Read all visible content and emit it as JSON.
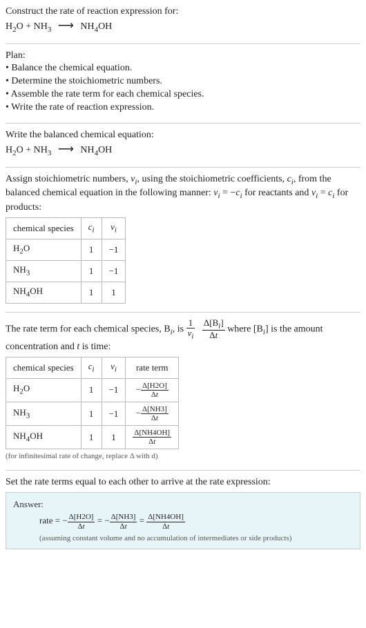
{
  "header": {
    "prompt": "Construct the rate of reaction expression for:"
  },
  "equation": {
    "r1": "H",
    "r1sub": "2",
    "r1tail": "O",
    "plus": " + ",
    "r2": "NH",
    "r2sub": "3",
    "arrow": "⟶",
    "p1": "NH",
    "p1sub": "4",
    "p1tail": "OH"
  },
  "plan": {
    "title": "Plan:",
    "b1": "• Balance the chemical equation.",
    "b2": "• Determine the stoichiometric numbers.",
    "b3": "• Assemble the rate term for each chemical species.",
    "b4": "• Write the rate of reaction expression."
  },
  "balanced": {
    "title": "Write the balanced chemical equation:"
  },
  "assign": {
    "text1": "Assign stoichiometric numbers, ",
    "nu": "ν",
    "sub_i": "i",
    "text2": ", using the stoichiometric coefficients, ",
    "c": "c",
    "text3": ", from the balanced chemical equation in the following manner: ",
    "eq1a": "ν",
    "eq1b": " = −",
    "eq1c": "c",
    "text4": " for reactants and ",
    "eq2a": "ν",
    "eq2b": " = ",
    "eq2c": "c",
    "text5": " for products:"
  },
  "table1": {
    "h1": "chemical species",
    "h2": "c",
    "h2sub": "i",
    "h3": "ν",
    "h3sub": "i",
    "rows": [
      {
        "sp1": "H",
        "sp1s": "2",
        "sp1t": "O",
        "c": "1",
        "nu": "−1"
      },
      {
        "sp1": "NH",
        "sp1s": "3",
        "sp1t": "",
        "c": "1",
        "nu": "−1"
      },
      {
        "sp1": "NH",
        "sp1s": "4",
        "sp1t": "OH",
        "c": "1",
        "nu": "1"
      }
    ]
  },
  "rateterm": {
    "t1": "The rate term for each chemical species, B",
    "t2": ", is ",
    "one": "1",
    "nu": "ν",
    "sub_i": "i",
    "dBi_num": "Δ[B",
    "dBi_sub": "i",
    "dBi_tail": "]",
    "dt": "Δt",
    "t3": " where [B",
    "t3sub": "i",
    "t3b": "] is the amount concentration and ",
    "t_it": "t",
    "t4": " is time:"
  },
  "table2": {
    "h1": "chemical species",
    "h2": "c",
    "h2sub": "i",
    "h3": "ν",
    "h3sub": "i",
    "h4": "rate term",
    "neg": "−",
    "d": "Δ",
    "dt": "Δt",
    "rows": [
      {
        "sp1": "H",
        "sp1s": "2",
        "sp1t": "O",
        "c": "1",
        "nu": "−1",
        "neg": "−",
        "num": "Δ[H2O]"
      },
      {
        "sp1": "NH",
        "sp1s": "3",
        "sp1t": "",
        "c": "1",
        "nu": "−1",
        "neg": "−",
        "num": "Δ[NH3]"
      },
      {
        "sp1": "NH",
        "sp1s": "4",
        "sp1t": "OH",
        "c": "1",
        "nu": "1",
        "neg": "",
        "num": "Δ[NH4OH]"
      }
    ],
    "footnote": "(for infinitesimal rate of change, replace Δ with d)"
  },
  "setequal": {
    "text": "Set the rate terms equal to each other to arrive at the rate expression:"
  },
  "answer": {
    "label": "Answer:",
    "rate": "rate",
    "eq": " = ",
    "neg": "−",
    "n1": "Δ[H2O]",
    "n2": "Δ[NH3]",
    "n3": "Δ[NH4OH]",
    "dt": "Δt",
    "note": "(assuming constant volume and no accumulation of intermediates or side products)"
  }
}
